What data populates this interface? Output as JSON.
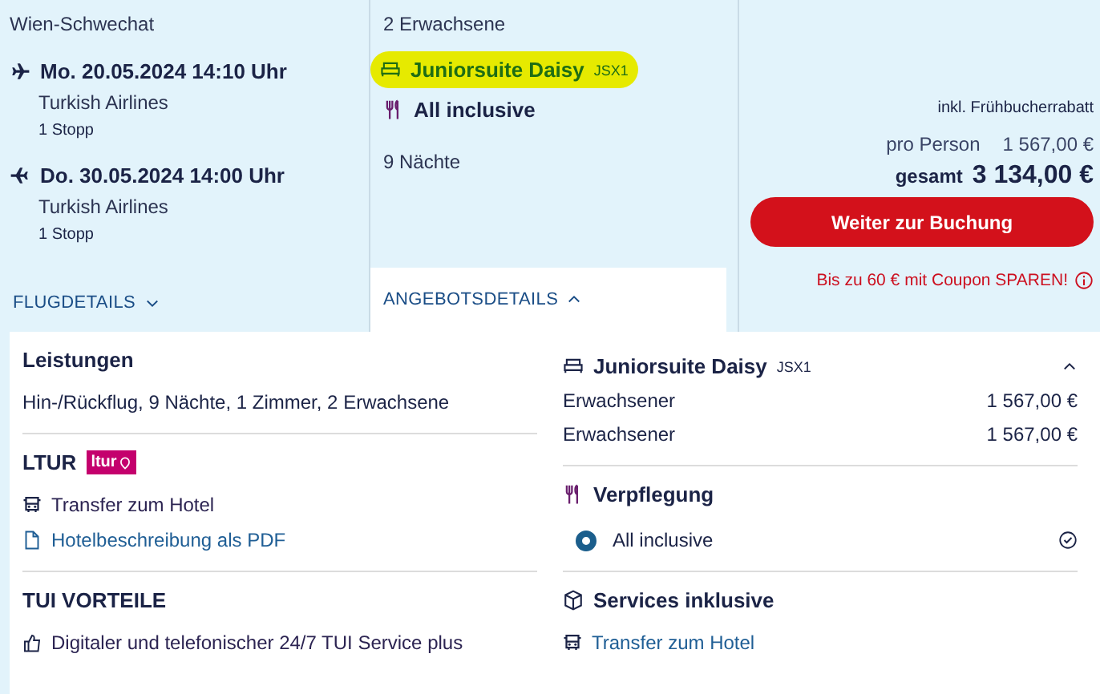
{
  "flights": {
    "origin": "Wien-Schwechat",
    "legs": [
      {
        "kind": "outbound",
        "datetime": "Mo. 20.05.2024 14:10 Uhr",
        "airline": "Turkish Airlines",
        "stops": "1 Stopp"
      },
      {
        "kind": "return",
        "datetime": "Do. 30.05.2024 14:00 Uhr",
        "airline": "Turkish Airlines",
        "stops": "1 Stopp"
      }
    ]
  },
  "offer": {
    "travellers": "2 Erwachsene",
    "room": {
      "name": "Juniorsuite Daisy",
      "code": "JSX1",
      "highlighted": true
    },
    "board": "All inclusive",
    "nights": "9 Nächte"
  },
  "price": {
    "discount_note": "inkl. Frühbucherrabatt",
    "per_person_label": "pro Person",
    "per_person": "1 567,00 €",
    "total_label": "gesamt",
    "total": "3 134,00 €",
    "button": "Weiter zur Buchung",
    "coupon": "Bis zu 60 € mit Coupon SPAREN!"
  },
  "tabs": [
    {
      "label": "FLUGDETAILS",
      "selected": false
    },
    {
      "label": "ANGEBOTSDETAILS",
      "selected": true
    }
  ],
  "details": {
    "left": [
      {
        "kind": "text",
        "title": "Leistungen",
        "text": "Hin-/Rückflug, 9 Nächte, 1 Zimmer, 2 Erwachsene"
      },
      {
        "kind": "list",
        "title": "LTUR",
        "badge": "ltur",
        "items": [
          {
            "kind": "bus",
            "label": "Transfer zum Hotel",
            "link": false
          },
          {
            "kind": "document",
            "label": "Hotelbeschreibung als PDF",
            "link": true
          }
        ]
      },
      {
        "kind": "list",
        "title": "TUI VORTEILE",
        "items": [
          {
            "kind": "thumb",
            "label": "Digitaler und telefonischer 24/7 TUI Service plus",
            "link": false
          }
        ]
      }
    ],
    "right": [
      {
        "kind": "prices",
        "title": "Juniorsuite Daisy",
        "code": "JSX1",
        "expanded": true,
        "rows": [
          {
            "label": "Erwachsener",
            "price": "1 567,00 €"
          },
          {
            "label": "Erwachsener",
            "price": "1 567,00 €"
          }
        ]
      },
      {
        "kind": "options",
        "title": "Verpflegung",
        "options": [
          {
            "label": "All inclusive",
            "selected": true
          }
        ]
      },
      {
        "kind": "list",
        "title": "Services inklusive",
        "items": [
          {
            "kind": "bus",
            "label": "Transfer zum Hotel",
            "link": true
          }
        ]
      }
    ]
  }
}
